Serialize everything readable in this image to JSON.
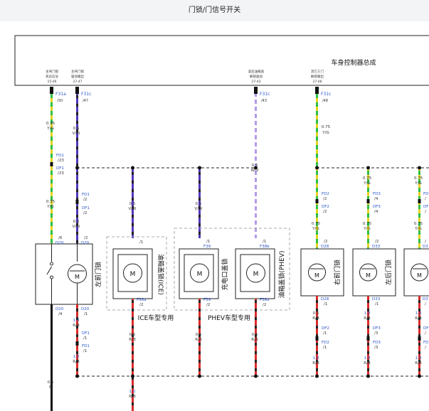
{
  "header": {
    "title": "门锁/门信号开关"
  },
  "bcm": {
    "title": "车身控制器总成",
    "pin_labels": [
      {
        "l1": "主驾门锁",
        "l2": "状态信号",
        "l3": "15-06"
      },
      {
        "l1": "主驾门锁",
        "l2": "驱动输出",
        "l3": "27-47"
      },
      {
        "l1": "高压油箱盖",
        "l2": "解锁驱动",
        "l3": "27-43"
      },
      {
        "l1": "其它三门",
        "l2": "解锁输出",
        "l3": "27-48"
      }
    ]
  },
  "connectors": {
    "c1": [
      "F31a",
      "/30"
    ],
    "c2": [
      "F31c",
      "/47"
    ],
    "c3": [
      "F31c",
      "/43"
    ],
    "c4": [
      "F31c",
      "/48"
    ]
  },
  "wires": {
    "w1a": [
      "0.35",
      "Y/G"
    ],
    "w1b": [
      "0.35",
      "Y/G"
    ],
    "w2a": [
      "0.5",
      "V/Bl"
    ],
    "w2b": [
      "0.5",
      "V/Bl"
    ],
    "w_ice": [
      "0.5",
      "V/Bl"
    ],
    "w_chg": [
      "0.5",
      "V/Bl"
    ],
    "w3": [
      "0.5",
      "W/V"
    ],
    "w4a": [
      "0.75",
      "Y/G"
    ],
    "w4b": [
      "0.75",
      "Y/G"
    ],
    "w5a": [
      "0.75",
      "Y/G"
    ],
    "w5b": [
      "0.75",
      "Y/G"
    ],
    "w6a": [
      "0.75",
      "Y/G"
    ],
    "w6b": [
      "0.75",
      "Y/G"
    ],
    "b1": [
      "1.0",
      "R/B"
    ],
    "b1b": [
      "1.0",
      "R/B"
    ],
    "b_g": [
      "0.5",
      "B"
    ],
    "b_ice": [
      "0.5",
      "R/B"
    ],
    "b_ice2": [
      "1.0",
      "R/B"
    ],
    "b_chg": [
      "0.5",
      "R/B"
    ],
    "b_phev": [
      "0.5",
      "R/B"
    ],
    "b_rf": [
      "0.5",
      "R/B"
    ],
    "b_rf2": [
      "1.0",
      "R/B"
    ],
    "b_lr": [
      "1.0",
      "R/B"
    ],
    "b_lr2": [
      "1.0",
      "R/B"
    ],
    "b_rr": [
      "1.0",
      "R/B"
    ],
    "b_rr2": [
      "1.0",
      "R/B"
    ]
  },
  "fd": {
    "a1": [
      "FD1",
      "/23"
    ],
    "a2": [
      "DF1",
      "/23"
    ],
    "b1": [
      "FD1",
      "/2"
    ],
    "b2": [
      "DF1",
      "/2"
    ],
    "c1": [
      "FD2",
      "/2"
    ],
    "c2": [
      "DF2",
      "/2"
    ],
    "d1": [
      "FD3",
      "/4"
    ],
    "d2": [
      "DF3",
      "/4"
    ],
    "e1": [
      "FD",
      "/"
    ],
    "e2": [
      "DF",
      "/"
    ],
    "f1": [
      "DF1",
      "/1"
    ],
    "f2": [
      "FD1",
      "/1"
    ],
    "g1": [
      "DF2",
      "/1"
    ],
    "g2": [
      "FD2",
      "/1"
    ],
    "h1": [
      "DF3",
      "/3"
    ],
    "h2": [
      "FD3",
      "/3"
    ],
    "i1": [
      "DF",
      "/"
    ],
    "i2": [
      "FD",
      "/"
    ]
  },
  "pins": {
    "d20_top": [
      "D20",
      "/6"
    ],
    "d20_top2": [
      "D20",
      "/2"
    ],
    "d20_bot": [
      "D20",
      "/4"
    ],
    "d20_bot2": [
      "D20",
      "/1"
    ],
    "ice_top": "/1",
    "ice_bot": [
      "F38a",
      "/2"
    ],
    "chg_top": [
      "F39",
      "/1"
    ],
    "chg_bot": [
      "F39",
      "/2"
    ],
    "phev_top": [
      "F38b",
      "/1"
    ],
    "phev_bot": [
      "F38a",
      "/2"
    ],
    "rf_top": [
      "D28",
      "/2"
    ],
    "rf_bot": [
      "D28",
      "/1"
    ],
    "lr_top": [
      "D33",
      "/2"
    ],
    "lr_bot": [
      "D33",
      "/1"
    ],
    "rr_top": [
      "D3",
      "/"
    ],
    "rr_bot": [
      "D3",
      "/"
    ]
  },
  "components": {
    "lf": "左前门锁",
    "ice": "油箱盖锁(ICE)",
    "chg": "充电口盖锁",
    "phev": "油箱盖锁(PHEV)",
    "rf": "右前门锁",
    "lr": "左后门锁",
    "motor": "M"
  },
  "groups": {
    "ice": "ICE车型专用",
    "phev": "PHEV车型专用"
  },
  "colors": {
    "yg": "#e3d321",
    "yg_alt": "#2fbf48",
    "vbl": "#5436b8",
    "vbl_alt": "#222222",
    "wv": "#b49ae8",
    "rb": "#d72b2b",
    "rb_alt": "#222222",
    "ground": "#111111",
    "blue_text": "#2a55c8"
  }
}
